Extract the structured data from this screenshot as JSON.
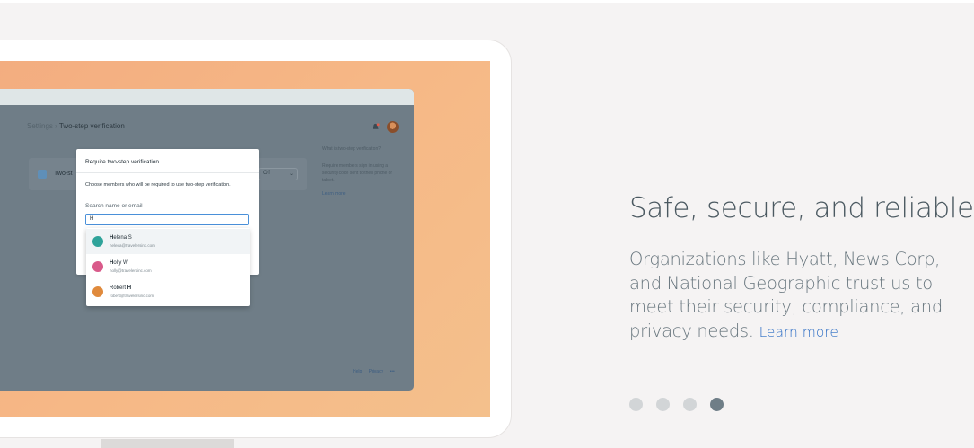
{
  "illustration": {
    "breadcrumb_parent": "Settings",
    "breadcrumb_sep": " › ",
    "breadcrumb_current": "Two-step verification",
    "setting_label": "Two-st",
    "setting_value": "Off",
    "help_title": "What is two-step verification?",
    "help_body": "Require members sign in using a security code sent to their phone or tablet.",
    "help_link": "Learn more",
    "footer_links": [
      "Help",
      "Privacy",
      "•••"
    ],
    "modal": {
      "title": "Require two-step verification",
      "description": "Choose members who will be required to use two-step verification.",
      "search_label": "Search name or email",
      "search_value": "H"
    },
    "suggestions": [
      {
        "pre": "",
        "bold": "H",
        "post": "elena S",
        "email": "helena@travelersinc.com",
        "avatar_color": "#2fa39a"
      },
      {
        "pre": "",
        "bold": "H",
        "post": "olly W",
        "email": "holly@travelersinc.com",
        "avatar_color": "#d95a8a"
      },
      {
        "pre": "Robert ",
        "bold": "H",
        "post": "",
        "email": "robert@travelersinc.com",
        "avatar_color": "#e08a3c"
      }
    ]
  },
  "content": {
    "headline": "Safe, secure, and reliable",
    "body": "Organizations like Hyatt, News Corp, and National Geographic trust us to meet their security, compliance, and privacy needs.",
    "learn_more": "Learn more"
  },
  "carousel": {
    "slide_count": 4,
    "active_index": 3
  },
  "colors": {
    "accent_link": "#2b6cc4",
    "dot_active": "#6f7e87",
    "dot_inactive": "#d2d5d7"
  }
}
